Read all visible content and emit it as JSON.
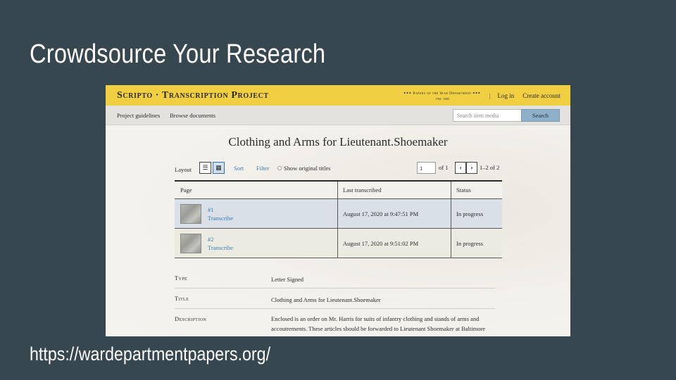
{
  "slide": {
    "title": "Crowdsource Your Research",
    "url": "https://wardepartmentpapers.org/"
  },
  "site": {
    "title": "Scripto · Transcription Project",
    "logo_line1": "Papers of the War Department",
    "logo_line2": "1784 - 1800",
    "logo_dots": "•••",
    "separator": "|",
    "login": "Log in",
    "create_account": "Create account"
  },
  "nav": {
    "project_guidelines": "Project guidelines",
    "browse_documents": "Browse documents",
    "search_placeholder": "Search item media",
    "search_button": "Search"
  },
  "item": {
    "title": "Clothing and Arms for Lieutenant.Shoemaker"
  },
  "controls": {
    "layout": "Layout",
    "list_icon": "list-icon",
    "grid_icon": "grid-icon",
    "sort": "Sort",
    "filter": "Filter",
    "show_original_titles": "Show original titles",
    "page_value": "1",
    "of_pages": "of 1",
    "prev": "‹",
    "next": "›",
    "range": "1–2 of 2"
  },
  "table": {
    "headers": [
      "Page",
      "Last transcribed",
      "Status"
    ],
    "rows": [
      {
        "page": "#1",
        "action": "Transcribe",
        "last": "August 17, 2020 at 9:47:51 PM",
        "status": "In progress"
      },
      {
        "page": "#2",
        "action": "Transcribe",
        "last": "August 17, 2020 at 9:51:02 PM",
        "status": "In progress"
      }
    ]
  },
  "metadata": [
    {
      "label": "Type",
      "value": "Letter Signed"
    },
    {
      "label": "Title",
      "value": "Clothing and Arms for Lieutenant.Shoemaker"
    },
    {
      "label": "Description",
      "value": "Enclosed is an order on Mr. Harris for suits of infantry clothing and stands of arms and accoutrements. These articles should be forwarded to Lieutenant Shoemaker at Baltimore"
    }
  ],
  "colors": {
    "slide_bg": "#37474f",
    "topbar": "#f1cf42",
    "link": "#3a7bb8",
    "search_button": "#8fb0c8",
    "row_highlight": "#d9e0e7"
  }
}
